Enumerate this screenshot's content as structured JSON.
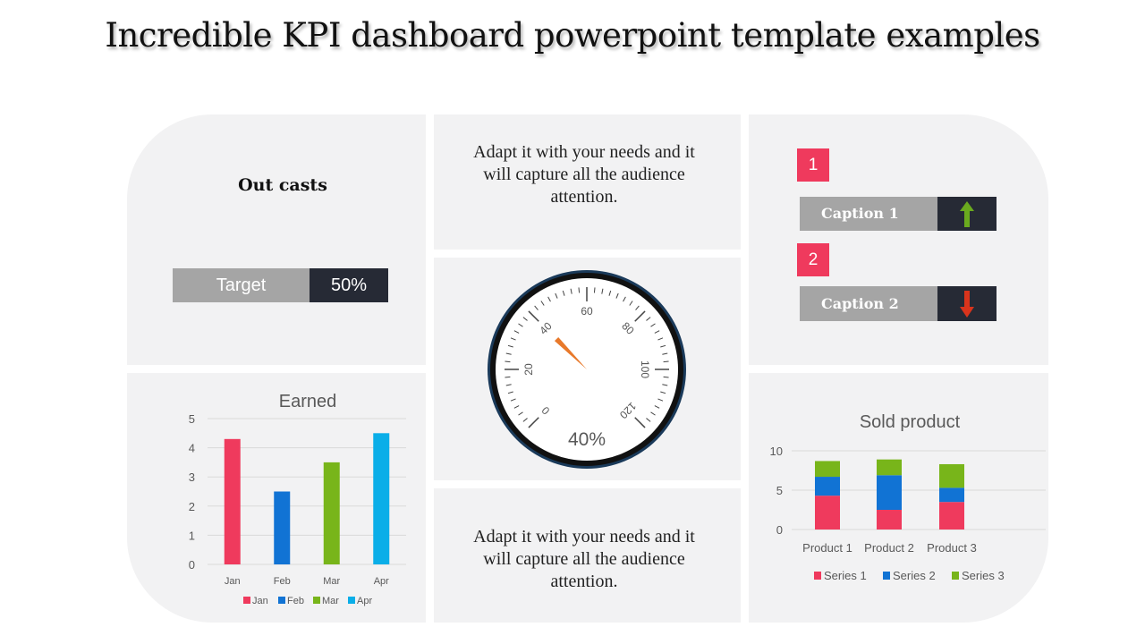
{
  "title": "Incredible KPI dashboard powerpoint template examples",
  "outcasts": {
    "heading": "Out casts",
    "target_label": "Target",
    "target_value": "50%"
  },
  "text_top": "Adapt it with your needs and it will capture all the audience attention.",
  "text_bottom": "Adapt it with your needs and it will capture all the audience attention.",
  "gauge": {
    "value": 40,
    "readout": "40%",
    "ticks": [
      "0",
      "20",
      "40",
      "60",
      "80",
      "100",
      "120"
    ],
    "min": 0,
    "max": 120,
    "needle_color": "#e8792b"
  },
  "captions": [
    {
      "number": "1",
      "label": "Caption 1",
      "arrow": "arrow-up-icon",
      "arrow_color": "#6aaa1e"
    },
    {
      "number": "2",
      "label": "Caption 2",
      "arrow": "arrow-down-icon",
      "arrow_color": "#d9341c"
    }
  ],
  "colors": {
    "accent": "#ef3a5d",
    "dark": "#262a35",
    "grey": "#a5a5a5"
  },
  "chart_data": [
    {
      "type": "bar",
      "title": "Earned",
      "categories": [
        "Jan",
        "Feb",
        "Mar",
        "Apr"
      ],
      "values": [
        4.3,
        2.5,
        3.5,
        4.5
      ],
      "colors": [
        "#ef3a5d",
        "#1173d4",
        "#78b51a",
        "#0aaee8"
      ],
      "ylim": [
        0,
        5
      ],
      "yticks": [
        "0",
        "1",
        "2",
        "3",
        "4",
        "5"
      ],
      "legend": [
        "Jan",
        "Feb",
        "Mar",
        "Apr"
      ],
      "legend_position": "bottom",
      "grid": true
    },
    {
      "type": "bar",
      "stacked": true,
      "title": "Sold product",
      "categories": [
        "Product 1",
        "Product 2",
        "Product 3"
      ],
      "series": [
        {
          "name": "Series 1",
          "values": [
            4.3,
            2.5,
            3.5
          ],
          "color": "#ef3a5d"
        },
        {
          "name": "Series 2",
          "values": [
            2.4,
            4.4,
            1.8
          ],
          "color": "#1173d4"
        },
        {
          "name": "Series 3",
          "values": [
            2,
            2,
            3
          ],
          "color": "#78b51a"
        }
      ],
      "ylim": [
        0,
        10
      ],
      "yticks": [
        "0",
        "5",
        "10"
      ],
      "legend_position": "bottom",
      "grid": true
    }
  ]
}
